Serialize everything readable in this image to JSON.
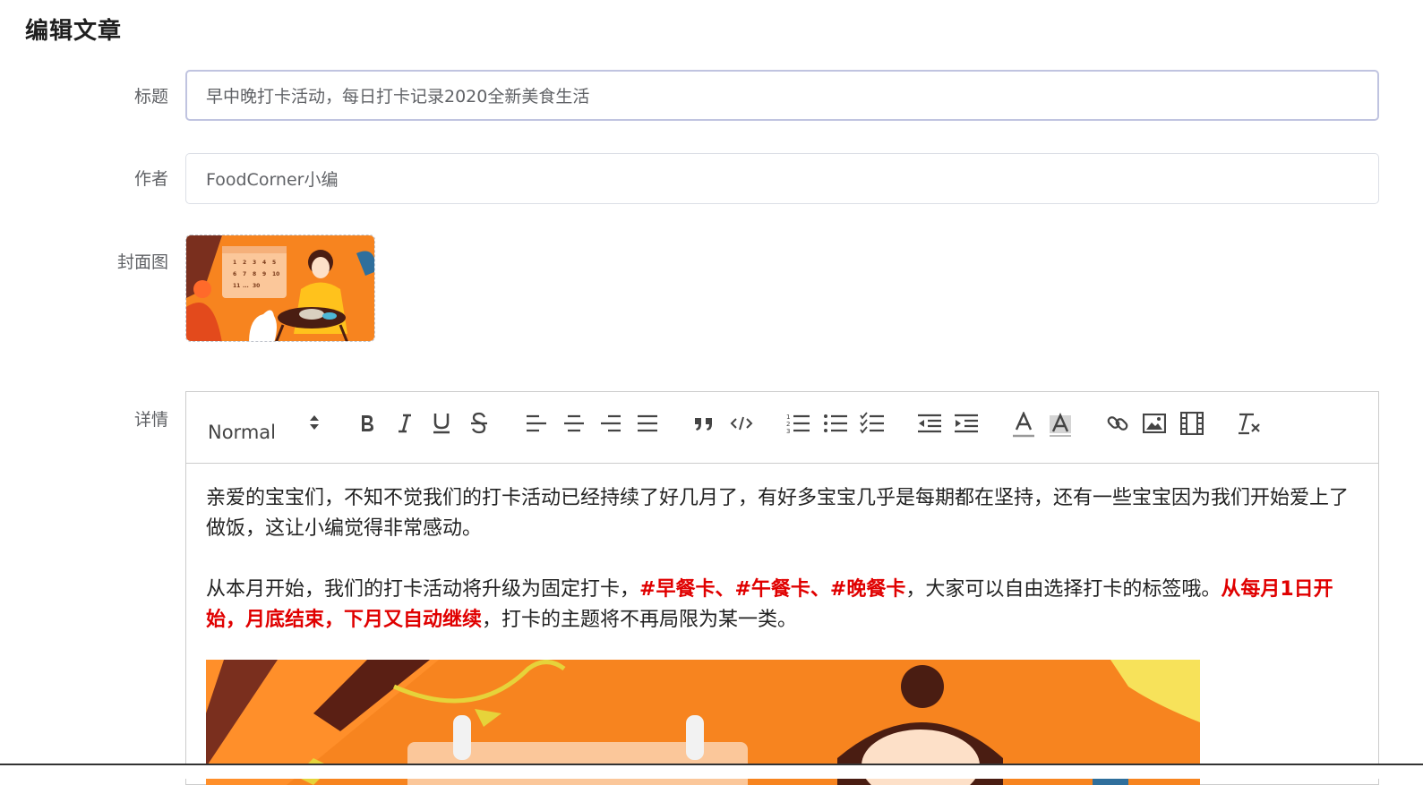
{
  "page": {
    "title": "编辑文章"
  },
  "form": {
    "title_label": "标题",
    "title_value": "早中晚打卡活动，每日打卡记录2020全新美食生活",
    "author_label": "作者",
    "author_value": "FoodCorner小编",
    "cover_label": "封面图",
    "detail_label": "详情"
  },
  "editor": {
    "header_select": "Normal",
    "toolbar": [
      "bold-icon",
      "italic-icon",
      "underline-icon",
      "strike-icon",
      "align-left-icon",
      "align-center-icon",
      "align-right-icon",
      "align-justify-icon",
      "blockquote-icon",
      "code-block-icon",
      "ordered-list-icon",
      "bullet-list-icon",
      "check-list-icon",
      "indent-decrease-icon",
      "indent-increase-icon",
      "font-color-icon",
      "background-color-icon",
      "link-icon",
      "image-icon",
      "video-icon",
      "clean-format-icon"
    ],
    "paragraph1": " 亲爱的宝宝们，不知不觉我们的打卡活动已经持续了好几月了，有好多宝宝几乎是每期都在坚持，还有一些宝宝因为我们开始爱上了做饭，这让小编觉得非常感动。",
    "paragraph2_a": "从本月开始，我们的打卡活动将升级为固定打卡，",
    "paragraph2_b": "#早餐卡、#午餐卡、#晚餐卡",
    "paragraph2_c": "，大家可以自由选择打卡的标签哦。",
    "paragraph2_d": "从每月1日开始，月底结束，下月又自动继续",
    "paragraph2_e": "，打卡的主题将不再局限为某一类。"
  },
  "calendar_numbers": [
    "1",
    "2",
    "3",
    "4",
    "5",
    "6",
    "7",
    "8",
    "9",
    "10",
    "11",
    "...",
    "30"
  ],
  "colors": {
    "highlight": "#e00000",
    "orange": "#f7841f",
    "border": "#dcdfe6"
  }
}
